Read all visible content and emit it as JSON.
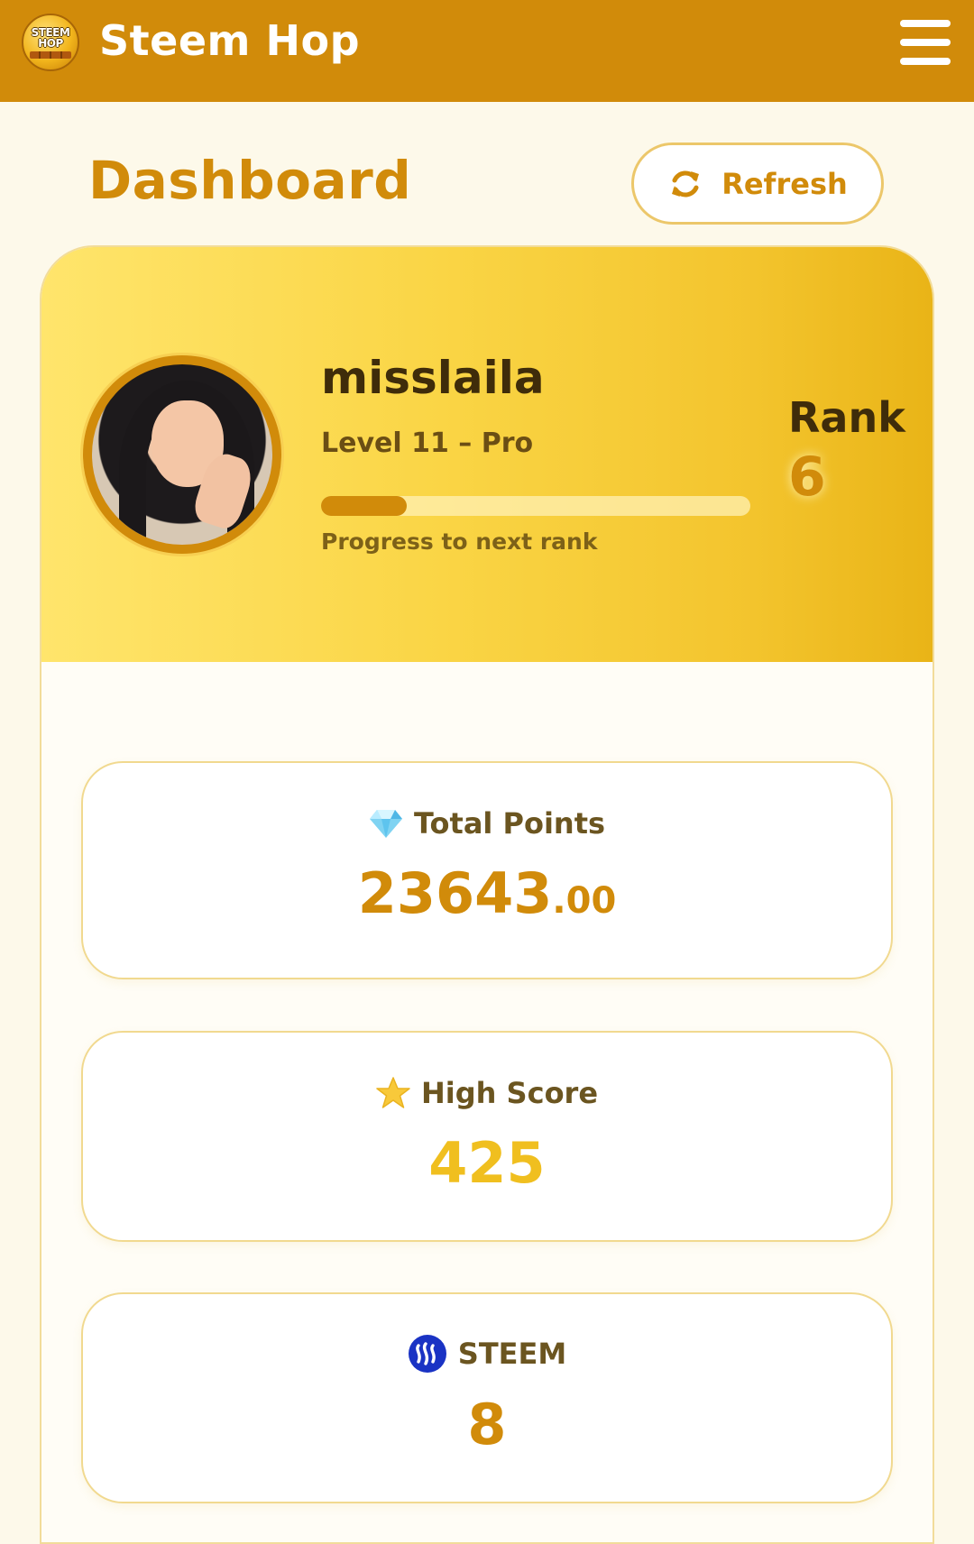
{
  "app": {
    "title": "Steem Hop",
    "logo_line1": "STEEM",
    "logo_line2": "HOP",
    "menu_icon": "hamburger-menu-icon"
  },
  "header": {
    "title": "Dashboard",
    "refresh_label": "Refresh",
    "refresh_icon": "refresh-icon"
  },
  "profile": {
    "username": "misslaila",
    "level": "Level 11 – Pro",
    "progress_percent": 20,
    "progress_caption": "Progress to next rank",
    "rank_label": "Rank",
    "rank_value": "6"
  },
  "stats": {
    "total_points": {
      "icon": "diamond-icon",
      "label": "Total Points",
      "integer": "23643",
      "decimals": ".00"
    },
    "high_score": {
      "icon": "star-icon",
      "label": "High Score",
      "value": "425"
    },
    "steem": {
      "icon": "steem-logo-icon",
      "label": "STEEM",
      "value": "8"
    }
  },
  "colors": {
    "brand": "#d18b0a",
    "banner_start": "#ffe56c",
    "banner_end": "#e9b417",
    "high_score": "#f0bf1f",
    "steem_blue": "#1a33c4"
  }
}
